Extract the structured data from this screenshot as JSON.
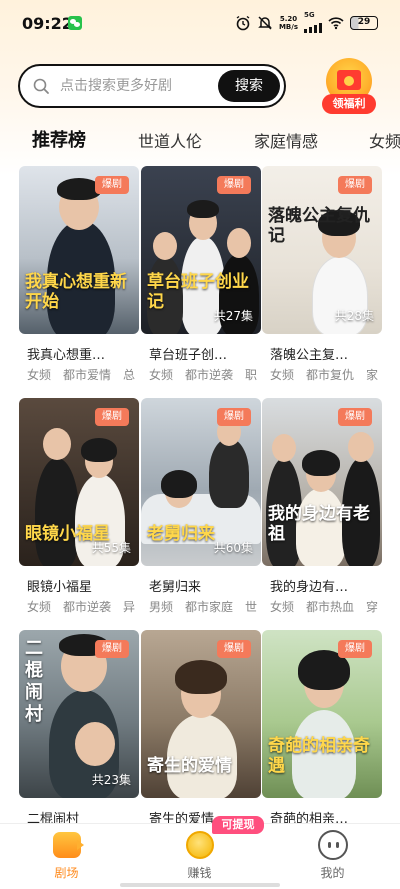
{
  "status_bar": {
    "time": "09:22",
    "net_speed_value": "5.20",
    "net_speed_unit": "MB/s",
    "network": "5G",
    "battery": "29"
  },
  "search": {
    "placeholder": "点击搜索更多好剧",
    "button_label": "搜索"
  },
  "welfare": {
    "label": "领福利"
  },
  "tabs": [
    {
      "label": "推荐榜",
      "active": true
    },
    {
      "label": "世道人伦",
      "active": false
    },
    {
      "label": "家庭情感",
      "active": false
    },
    {
      "label": "女频",
      "active": false
    }
  ],
  "cards": [
    {
      "title": "我真心想重…",
      "poster_text": "我真心想重新开始",
      "badge": "爆剧",
      "episodes": "",
      "tags": [
        "女频",
        "都市爱情",
        "总"
      ]
    },
    {
      "title": "草台班子创…",
      "poster_text": "草台班子创业记",
      "badge": "爆剧",
      "episodes": "共27集",
      "tags": [
        "女频",
        "都市逆袭",
        "职"
      ]
    },
    {
      "title": "落魄公主复…",
      "poster_text": "落魄公主复仇记",
      "badge": "爆剧",
      "episodes": "共28集",
      "tags": [
        "女频",
        "都市复仇",
        "家"
      ]
    },
    {
      "title": "眼镜小福星",
      "poster_text": "眼镜小福星",
      "badge": "爆剧",
      "episodes": "共55集",
      "tags": [
        "女频",
        "都市逆袭",
        "异"
      ]
    },
    {
      "title": "老舅归来",
      "poster_text": "老舅归来",
      "badge": "爆剧",
      "episodes": "共60集",
      "tags": [
        "男频",
        "都市家庭",
        "世"
      ]
    },
    {
      "title": "我的身边有…",
      "poster_text": "我的身边有老祖",
      "badge": "爆剧",
      "episodes": "",
      "tags": [
        "女频",
        "都市热血",
        "穿"
      ]
    },
    {
      "title": "二棍闹村",
      "poster_text": "二棍闹村",
      "badge": "爆剧",
      "episodes": "共23集",
      "tags": []
    },
    {
      "title": "寄生的爱情",
      "poster_text": "寄生的爱情",
      "badge": "爆剧",
      "episodes": "",
      "tags": []
    },
    {
      "title": "奇葩的相亲…",
      "poster_text": "奇葩的相亲奇遇",
      "badge": "爆剧",
      "episodes": "",
      "tags": []
    }
  ],
  "bottom_nav": [
    {
      "label": "剧场",
      "icon": "theater-icon",
      "active": true
    },
    {
      "label": "赚钱",
      "icon": "coin-icon",
      "active": false,
      "badge": "可提现"
    },
    {
      "label": "我的",
      "icon": "me-icon",
      "active": false
    }
  ],
  "colors": {
    "accent": "#ff8a1c",
    "badge": "#f47a5a",
    "withdraw_badge": "#ff4f7e"
  }
}
